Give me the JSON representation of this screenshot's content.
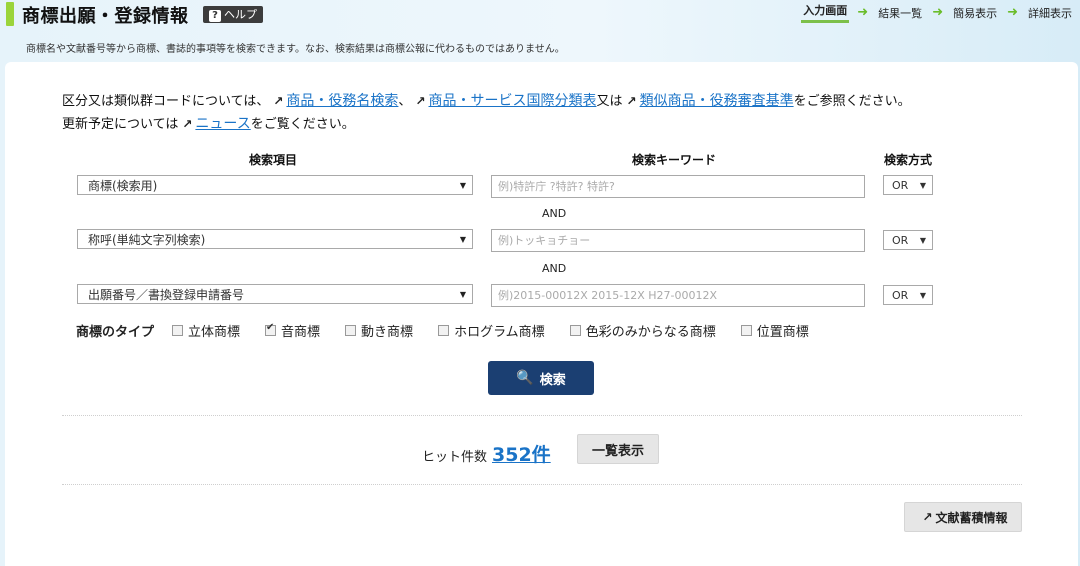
{
  "header": {
    "title": "商標出願・登録情報",
    "help_label": "ヘルプ",
    "help_icon": "?",
    "subtitle": "商標名や文献番号等から商標、書誌的事項等を検索できます。なお、検索結果は商標公報に代わるものではありません。",
    "steps": [
      "入力画面",
      "結果一覧",
      "簡易表示",
      "詳細表示"
    ],
    "active_step": 0
  },
  "info": {
    "line1_prefix": "区分又は類似群コードについては、",
    "link1": "商品・役務名検索",
    "sep1": "、",
    "link2": "商品・サービス国際分類表",
    "sep2": "又は",
    "link3": "類似商品・役務審査基準",
    "line1_suffix": "をご参照ください。",
    "line2_prefix": "更新予定については",
    "link4": "ニュース",
    "line2_suffix": "をご覧ください。"
  },
  "form": {
    "col_item": "検索項目",
    "col_keyword": "検索キーワード",
    "col_mode": "検索方式",
    "rows": [
      {
        "item": "商標(検索用)",
        "placeholder": "例)特許庁 ?特許? 特許?",
        "mode": "OR"
      },
      {
        "item": "称呼(単純文字列検索)",
        "placeholder": "例)トッキョチョー",
        "mode": "OR"
      },
      {
        "item": "出願番号／書換登録申請番号",
        "placeholder": "例)2015-00012X 2015-12X H27-00012X",
        "mode": "OR"
      }
    ],
    "and_label": "AND",
    "types_label": "商標のタイプ",
    "types": [
      {
        "label": "立体商標",
        "checked": false
      },
      {
        "label": "音商標",
        "checked": true
      },
      {
        "label": "動き商標",
        "checked": false
      },
      {
        "label": "ホログラム商標",
        "checked": false
      },
      {
        "label": "色彩のみからなる商標",
        "checked": false
      },
      {
        "label": "位置商標",
        "checked": false
      }
    ],
    "search_label": "検索"
  },
  "results": {
    "hit_label": "ヒット件数",
    "hit_count": "352件",
    "list_label": "一覧表示",
    "doc_label": "文献蓄積情報"
  },
  "colors": {
    "accent": "#1b3f72",
    "link": "#1a73c7",
    "green": "#7cc04a"
  }
}
